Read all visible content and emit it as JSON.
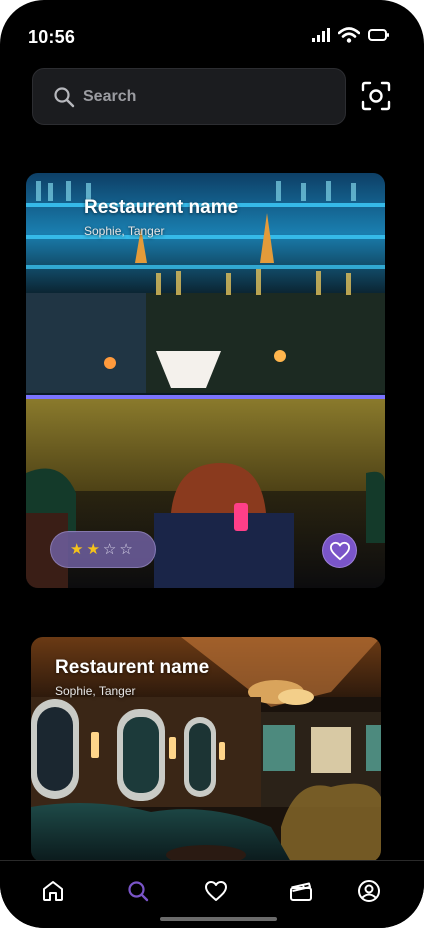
{
  "status_bar": {
    "time": "10:56"
  },
  "search": {
    "placeholder": "Search"
  },
  "icons": {
    "search": "search-icon",
    "scan": "scan-icon",
    "heart": "heart-icon",
    "home": "home-icon",
    "clapperboard": "clapperboard-icon",
    "profile": "profile-icon"
  },
  "colors": {
    "accent": "#7a55c9",
    "star": "#f4c21b",
    "background": "#000000"
  },
  "restaurants": [
    {
      "name": "Restaurent name",
      "location": "Sophie, Tanger",
      "rating": "2 of 4 stars",
      "stars": [
        "★",
        "★",
        "☆",
        "☆"
      ]
    },
    {
      "name": "Restaurent name",
      "location": "Sophie, Tanger"
    }
  ],
  "nav": {
    "items": [
      "home",
      "search",
      "favorites",
      "media",
      "profile"
    ],
    "active": "search"
  }
}
